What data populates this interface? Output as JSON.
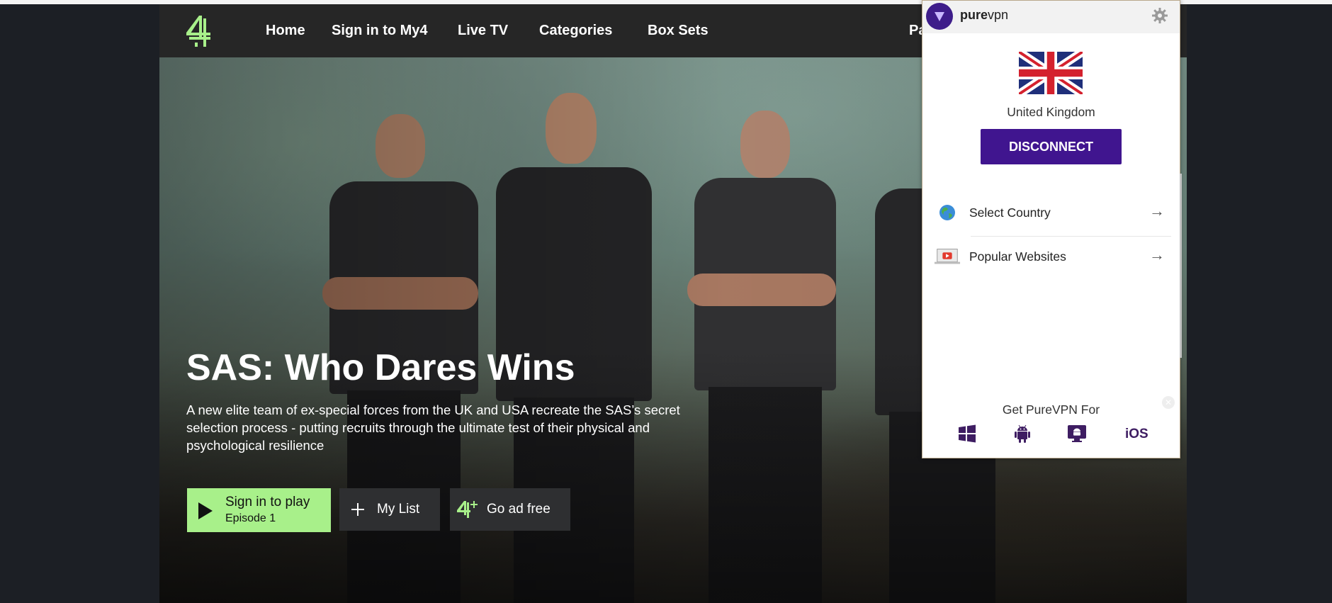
{
  "nav": {
    "items": [
      {
        "label": "Home"
      },
      {
        "label": "Sign in to My4"
      },
      {
        "label": "Live TV"
      },
      {
        "label": "Categories"
      },
      {
        "label": "Box Sets"
      },
      {
        "label": "Pa"
      }
    ]
  },
  "hero": {
    "title": "SAS: Who Dares Wins",
    "description": "A new elite team of ex-special forces from the UK and USA recreate the SAS’s secret selection process - putting recruits through the ultimate test of their physical and psychological resilience",
    "play_button": {
      "line1": "Sign in to play",
      "line2": "Episode 1"
    },
    "mylist_label": "My List",
    "adfree_label": "Go ad free"
  },
  "vpn": {
    "brand_bold": "pure",
    "brand_light": "vpn",
    "country": "United Kingdom",
    "disconnect_label": "DISCONNECT",
    "rows": [
      {
        "label": "Select Country",
        "icon": "globe-icon"
      },
      {
        "label": "Popular Websites",
        "icon": "laptop-youtube-icon"
      }
    ],
    "get_for_label": "Get PureVPN For",
    "platforms": [
      "windows-icon",
      "android-icon",
      "android-tv-icon"
    ],
    "ios_label": "iOS"
  },
  "colors": {
    "accent_green": "#a8f08a",
    "vpn_purple": "#40158f",
    "nav_bg": "#262626"
  }
}
